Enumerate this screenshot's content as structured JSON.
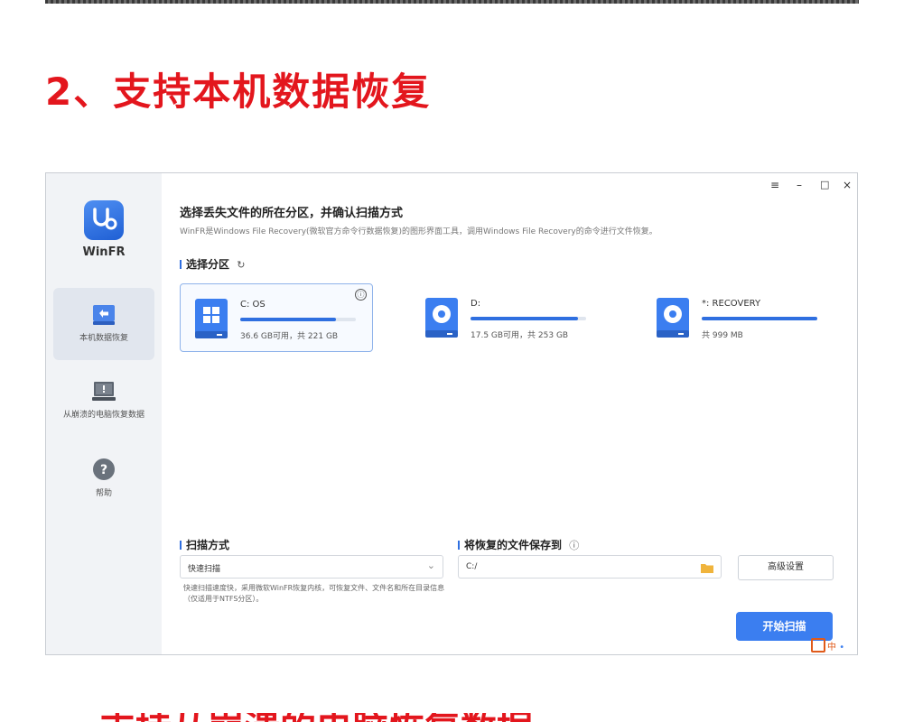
{
  "heading": "2、支持本机数据恢复",
  "bottom_heading": "支持从崩溃的电脑恢复数据",
  "sidebar": {
    "logo_text": "WinFR",
    "items": [
      {
        "label": "本机数据恢复",
        "icon": "return-arrow-icon",
        "active": true
      },
      {
        "label": "从崩溃的电脑恢复数据",
        "icon": "crashed-computer-icon",
        "active": false
      },
      {
        "label": "帮助",
        "icon": "help-icon",
        "active": false
      }
    ]
  },
  "window_controls": {
    "menu": "≡",
    "minimize": "–",
    "maximize": "□",
    "close": "×"
  },
  "main": {
    "title": "选择丢失文件的所在分区，并确认扫描方式",
    "description": "WinFR是Windows File Recovery(微软官方命令行数据恢复)的图形界面工具，调用Windows File Recovery的命令进行文件恢复。",
    "partition_label": "选择分区",
    "refresh_icon": "↻",
    "drives": [
      {
        "name": "C: OS",
        "size": "36.6 GB可用，共 221 GB",
        "usage_fraction": 0.83,
        "type": "windows-drive-icon",
        "selected": true,
        "info": "ⓘ"
      },
      {
        "name": "D:",
        "size": "17.5 GB可用，共 253 GB",
        "usage_fraction": 0.93,
        "type": "disk-drive-icon",
        "selected": false
      },
      {
        "name": "*: RECOVERY",
        "size": "共 999 MB",
        "usage_fraction": 1.0,
        "type": "disk-drive-icon",
        "selected": false
      }
    ],
    "scan_mode_label": "扫描方式",
    "scan_mode_value": "快速扫描",
    "scan_mode_desc": "快速扫描速度快，采用微软WinFR恢复内核，可恢复文件、文件名和所在目录信息（仅适用于NTFS分区）。",
    "save_to_label": "将恢复的文件保存到",
    "save_to_info": "ⓘ",
    "save_path": "C:/",
    "advanced_button": "高级设置",
    "start_button": "开始扫描"
  },
  "ime_badge": "中",
  "colors": {
    "accent": "#2f6fe0",
    "heading_red": "#e3161d",
    "start_button": "#3b7ef0"
  }
}
